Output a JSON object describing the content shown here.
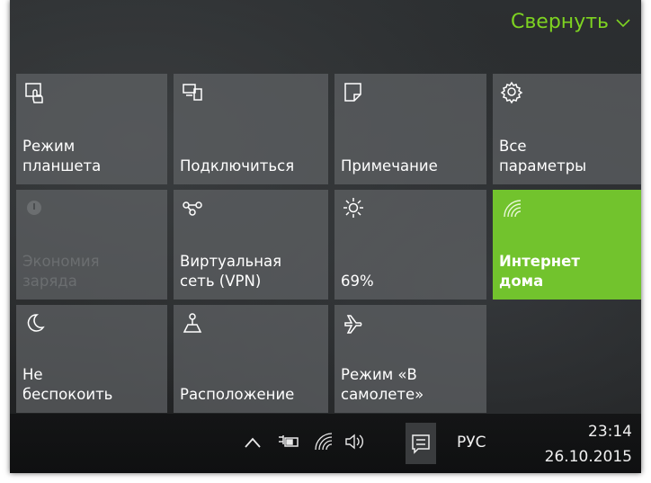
{
  "header": {
    "collapse_label": "Свернуть"
  },
  "tiles": [
    {
      "label": "Режим\nпланшета",
      "icon": "tablet-mode-icon",
      "state": "off"
    },
    {
      "label": "Подключиться",
      "icon": "connect-icon",
      "state": "off"
    },
    {
      "label": "Примечание",
      "icon": "note-icon",
      "state": "off"
    },
    {
      "label": "Все\nпараметры",
      "icon": "gear-icon",
      "state": "off"
    },
    {
      "label": "Экономия\nзаряда",
      "icon": "battery-saver-icon",
      "state": "disabled"
    },
    {
      "label": "Виртуальная\nсеть (VPN)",
      "icon": "vpn-icon",
      "state": "off"
    },
    {
      "label": "69%",
      "icon": "brightness-icon",
      "state": "off"
    },
    {
      "label": "Интернет\nдома",
      "icon": "wifi-icon",
      "state": "active"
    },
    {
      "label": "Не\nбеспокоить",
      "icon": "moon-icon",
      "state": "off"
    },
    {
      "label": "Расположение",
      "icon": "location-icon",
      "state": "off"
    },
    {
      "label": "Режим «В\nсамолете»",
      "icon": "airplane-icon",
      "state": "off"
    }
  ],
  "taskbar": {
    "language": "РУС",
    "time": "23:14",
    "date": "26.10.2015"
  },
  "colors": {
    "accent": "#72c32d",
    "collapse_text": "#7ed321"
  }
}
